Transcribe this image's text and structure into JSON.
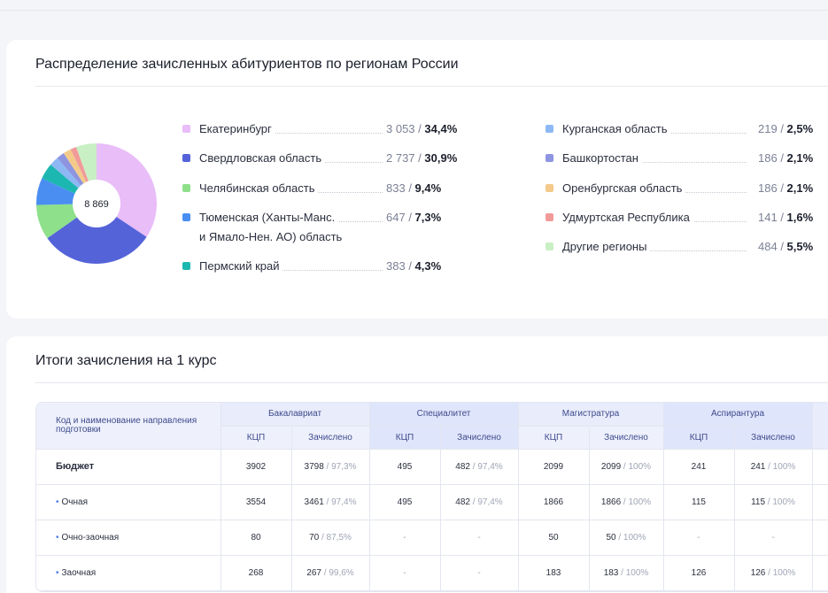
{
  "regions": {
    "title": "Распределение зачисленных абитуриентов по регионам России",
    "total": "8 869",
    "items": [
      {
        "name": "Екатеринбург",
        "count": "3 053",
        "pct": "34,4%",
        "value": 34.4,
        "color": "#e9bdf8"
      },
      {
        "name": "Свердловская область",
        "count": "2 737",
        "pct": "30,9%",
        "value": 30.9,
        "color": "#5563d9"
      },
      {
        "name": "Челябинская область",
        "count": "833",
        "pct": "9,4%",
        "value": 9.4,
        "color": "#8ee08a"
      },
      {
        "name": "Тюменская (Ханты-Манс.",
        "name2": "и Ямало-Нен. АО) область",
        "count": "647",
        "pct": "7,3%",
        "value": 7.3,
        "color": "#4a8ef2"
      },
      {
        "name": "Пермский край",
        "count": "383",
        "pct": "4,3%",
        "value": 4.3,
        "color": "#1cb7b0"
      },
      {
        "name": "Курганская область",
        "count": "219",
        "pct": "2,5%",
        "value": 2.5,
        "color": "#8db8f4"
      },
      {
        "name": "Башкортостан",
        "count": "186",
        "pct": "2,1%",
        "value": 2.1,
        "color": "#8d94e0"
      },
      {
        "name": "Оренбургская область",
        "count": "186",
        "pct": "2,1%",
        "value": 2.1,
        "color": "#f3ca8a"
      },
      {
        "name": "Удмуртская Республика",
        "count": "141",
        "pct": "1,6%",
        "value": 1.6,
        "color": "#f19a9a"
      },
      {
        "name": "Другие регионы",
        "count": "484",
        "pct": "5,5%",
        "value": 5.5,
        "color": "#c9efc4"
      }
    ]
  },
  "enrollment": {
    "title": "Итоги зачисления на 1 курс",
    "head_left": "Код и наименование направления подготовки",
    "groups": [
      "Бакалавриат",
      "Специалитет",
      "Магистратура",
      "Аспирантура"
    ],
    "sub_kcp": "КЦП",
    "sub_enrolled": "Зачислено",
    "rows": [
      {
        "name": "Бюджет",
        "bold": true,
        "cells": [
          [
            "3902",
            "3798",
            " / 97,3%"
          ],
          [
            "495",
            "482",
            " / 97,4%"
          ],
          [
            "2099",
            "2099",
            " / 100%"
          ],
          [
            "241",
            "241",
            " / 100%"
          ]
        ]
      },
      {
        "name": "Очная",
        "bullet": true,
        "cells": [
          [
            "3554",
            "3461",
            " / 97,4%"
          ],
          [
            "495",
            "482",
            " / 97,4%"
          ],
          [
            "1866",
            "1866",
            " / 100%"
          ],
          [
            "115",
            "115",
            " / 100%"
          ]
        ]
      },
      {
        "name": "Очно-заочная",
        "bullet": true,
        "cells": [
          [
            "80",
            "70",
            " / 87,5%"
          ],
          [
            "-",
            "-",
            ""
          ],
          [
            "50",
            "50",
            " / 100%"
          ],
          [
            "-",
            "-",
            ""
          ]
        ]
      },
      {
        "name": "Заочная",
        "bullet": true,
        "cells": [
          [
            "268",
            "267",
            " / 99,6%"
          ],
          [
            "-",
            "-",
            ""
          ],
          [
            "183",
            "183",
            " / 100%"
          ],
          [
            "126",
            "126",
            " / 100%"
          ]
        ]
      }
    ]
  }
}
